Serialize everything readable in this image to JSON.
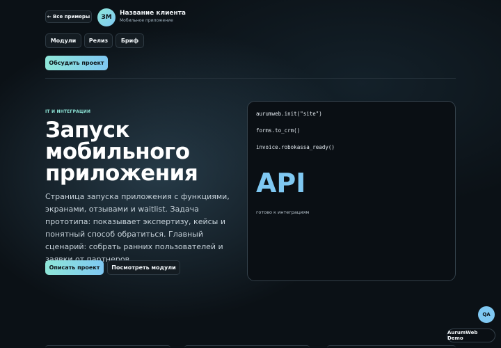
{
  "header": {
    "back_label": "← Все примеры",
    "logo_text": "ЗМ",
    "client_name": "Название клиента",
    "client_subtitle": "Мобильное приложение"
  },
  "tabs": [
    {
      "label": "Модули"
    },
    {
      "label": "Релиз"
    },
    {
      "label": "Бриф"
    }
  ],
  "discuss_label": "Обсудить проект",
  "hero": {
    "eyebrow": "IT И ИНТЕГРАЦИИ",
    "title": "Запуск мобильного приложения",
    "description": "Страница запуска приложения с функциями, экранами, отзывами и waitlist. Задача прототипа: показывает экспертизу, кейсы и понятный способ обратиться. Главный сценарий: собрать ранних пользователей и заявки от партнеров.",
    "primary_cta": "Описать проект",
    "secondary_cta": "Посмотреть модули"
  },
  "code_card": {
    "lines": [
      "aurumweb.init(\"site\")",
      "forms.to_crm()",
      "invoice.robokassa_ready()"
    ],
    "big_label": "API",
    "caption": "готово к интеграциям"
  },
  "floating": {
    "qa_label": "QA",
    "demo_label": "AurumWeb Demo"
  },
  "colors": {
    "background": "#0b1116",
    "accent_start": "#8ee6d8",
    "accent_end": "#7fc8f2",
    "eyebrow": "#8ee6d8",
    "api": "#7fc8f2"
  }
}
